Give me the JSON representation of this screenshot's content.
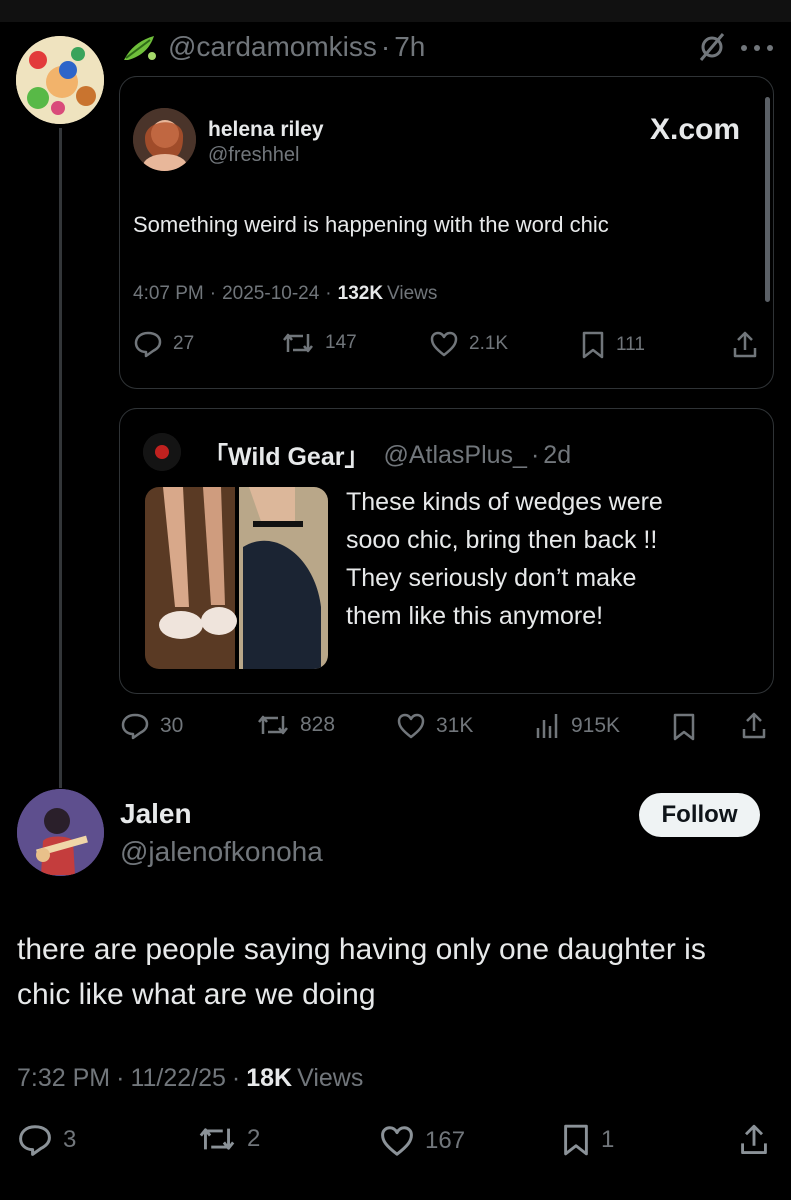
{
  "outer_post": {
    "handle": "@cardamomkiss",
    "time": "7h"
  },
  "quoted_post": {
    "name": "helena riley",
    "handle": "@freshhel",
    "brand": "X.com",
    "text": "Something weird is happening with the word chic",
    "time": "4:07 PM",
    "date": "2025-10-24",
    "views_count": "132K",
    "views_label": "Views",
    "stats": {
      "replies": "27",
      "reposts": "147",
      "likes": "2.1K",
      "bookmarks": "111"
    }
  },
  "nested_quote": {
    "name": "「Wild Gear」",
    "handle": "@AtlasPlus_",
    "time": "2d",
    "text_lines": [
      "These kinds of wedges were",
      "sooo chic, bring then back !!",
      "They seriously don’t make",
      "them like this anymore!"
    ]
  },
  "outer_stats": {
    "replies": "30",
    "reposts": "828",
    "likes": "31K",
    "views": "915K"
  },
  "main_post": {
    "name": "Jalen",
    "handle": "@jalenofkonoha",
    "follow_label": "Follow",
    "text_line1": "there are people saying having only one daughter is",
    "text_line2": "chic like what are we doing",
    "time": "7:32 PM",
    "date": "11/22/25",
    "views_count": "18K",
    "views_label": "Views",
    "stats": {
      "replies": "3",
      "reposts": "2",
      "likes": "167",
      "bookmarks": "1"
    }
  }
}
